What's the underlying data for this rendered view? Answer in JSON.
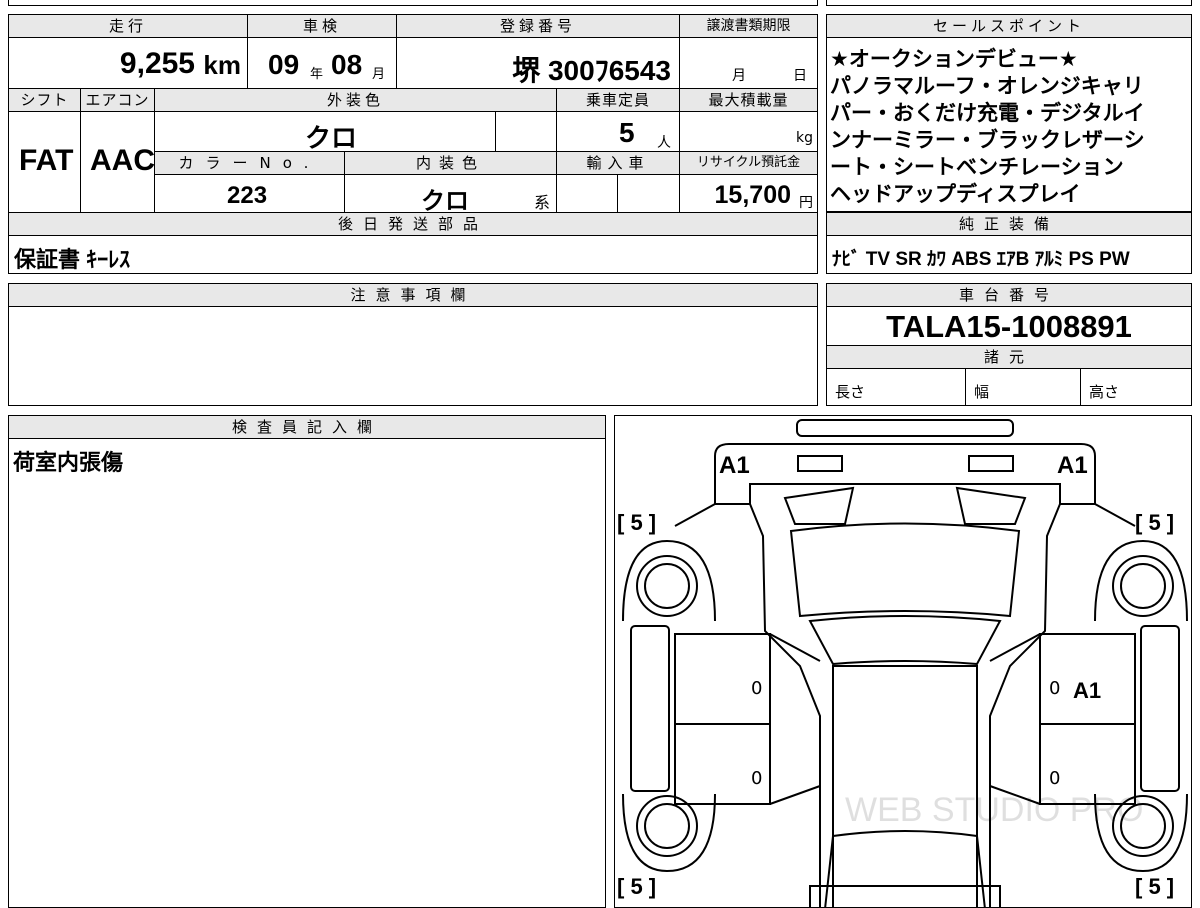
{
  "sheet": {
    "h_mileage": "走行",
    "h_inspection": "車検",
    "h_registration": "登録番号",
    "h_transfer_deadline": "譲渡書類期限",
    "h_sales_point": "セールスポイント",
    "mileage": "9,255",
    "mileage_unit": "km",
    "inspection_year": "09",
    "inspection_year_unit": "年",
    "inspection_month": "08",
    "inspection_month_unit": "月",
    "registration_number": "堺 300ﾌ6543",
    "deadline_month_unit": "月",
    "deadline_day_unit": "日",
    "h_shift": "シフト",
    "h_aircon": "エアコン",
    "h_exterior_color": "外装色",
    "h_capacity": "乗車定員",
    "h_max_load": "最大積載量",
    "shift": "FAT",
    "aircon": "AAC",
    "exterior_color": "クロ",
    "capacity": "5",
    "capacity_unit": "人",
    "max_load_unit": "kg",
    "h_color_no": "カラーNo.",
    "h_interior_color": "内装色",
    "h_import": "輸入車",
    "h_recycle_fee": "リサイクル預託金",
    "color_no": "223",
    "interior_color": "クロ",
    "interior_color_suffix": "系",
    "recycle_fee": "15,700",
    "recycle_fee_unit": "円",
    "sales_point_lines": [
      "★オークションデビュー★",
      "パノラマルーフ・オレンジキャリ",
      "パー・おくだけ充電・デジタルイ",
      "ンナーミラー・ブラックレザーシ",
      "ート・シートベンチレーション",
      "ヘッドアップディスプレイ"
    ],
    "h_later_parts": "後日発送部品",
    "later_parts": "保証書 ｷｰﾚｽ",
    "h_genuine_equipment": "純正装備",
    "genuine_equipment": "ﾅﾋﾞ TV SR ｶﾜ ABS ｴｱB ｱﾙﾐ PS PW",
    "h_notes": "注意事項欄",
    "h_chassis": "車台番号",
    "chassis_number": "TALA15-1008891",
    "h_specs": "諸元",
    "spec_length": "長さ",
    "spec_width": "幅",
    "spec_height": "高さ",
    "h_inspector": "検査員記入欄",
    "inspector_note": "荷室内張傷",
    "watermark": "WEB STUDIO PRO"
  },
  "diagram": {
    "front_left": "A1",
    "front_right": "A1",
    "rear_right_door": "A1",
    "bracket_top_left": "[ 5 ]",
    "bracket_top_right": "[ 5 ]",
    "bracket_bottom_left": "[ 5 ]",
    "bracket_bottom_right": "[ 5 ]",
    "door_mark": "0"
  }
}
